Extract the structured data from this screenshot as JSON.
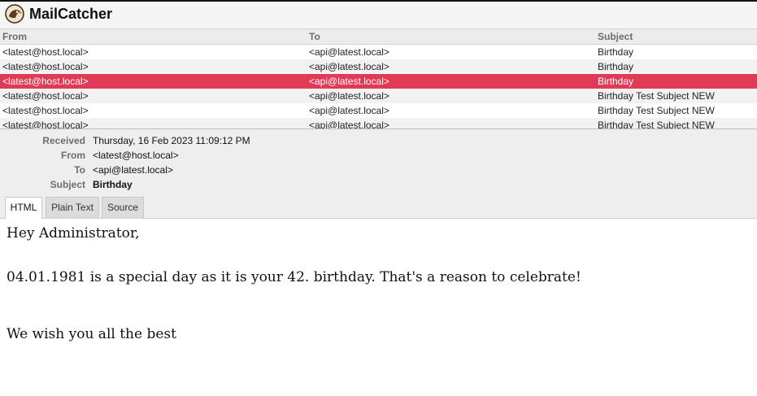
{
  "app": {
    "title": "MailCatcher",
    "logo_icon": "mailcatcher-logo-icon"
  },
  "list": {
    "columns": {
      "from": "From",
      "to": "To",
      "subject": "Subject"
    },
    "rows": [
      {
        "from": "<latest@host.local>",
        "to": "<api@latest.local>",
        "subject": "Birthday"
      },
      {
        "from": "<latest@host.local>",
        "to": "<api@latest.local>",
        "subject": "Birthday"
      },
      {
        "from": "<latest@host.local>",
        "to": "<api@latest.local>",
        "subject": "Birthday",
        "selected": true
      },
      {
        "from": "<latest@host.local>",
        "to": "<api@latest.local>",
        "subject": "Birthday Test Subject NEW"
      },
      {
        "from": "<latest@host.local>",
        "to": "<api@latest.local>",
        "subject": "Birthday Test Subject NEW"
      },
      {
        "from": "<latest@host.local>",
        "to": "<api@latest.local>",
        "subject": "Birthday Test Subject NEW"
      }
    ],
    "selected_color": "#e03a57"
  },
  "message": {
    "labels": {
      "received": "Received",
      "from": "From",
      "to": "To",
      "subject": "Subject"
    },
    "received": "Thursday, 16 Feb 2023 11:09:12 PM",
    "from": "<latest@host.local>",
    "to": "<api@latest.local>",
    "subject": "Birthday",
    "tabs": [
      {
        "label": "HTML",
        "active": true
      },
      {
        "label": "Plain Text",
        "active": false
      },
      {
        "label": "Source",
        "active": false
      }
    ],
    "body": {
      "greeting": "Hey Administrator,",
      "paragraph": "04.01.1981 is a special day as it is your 42. birthday. That's a reason to celebrate!",
      "closing": "We wish you all the best"
    }
  }
}
